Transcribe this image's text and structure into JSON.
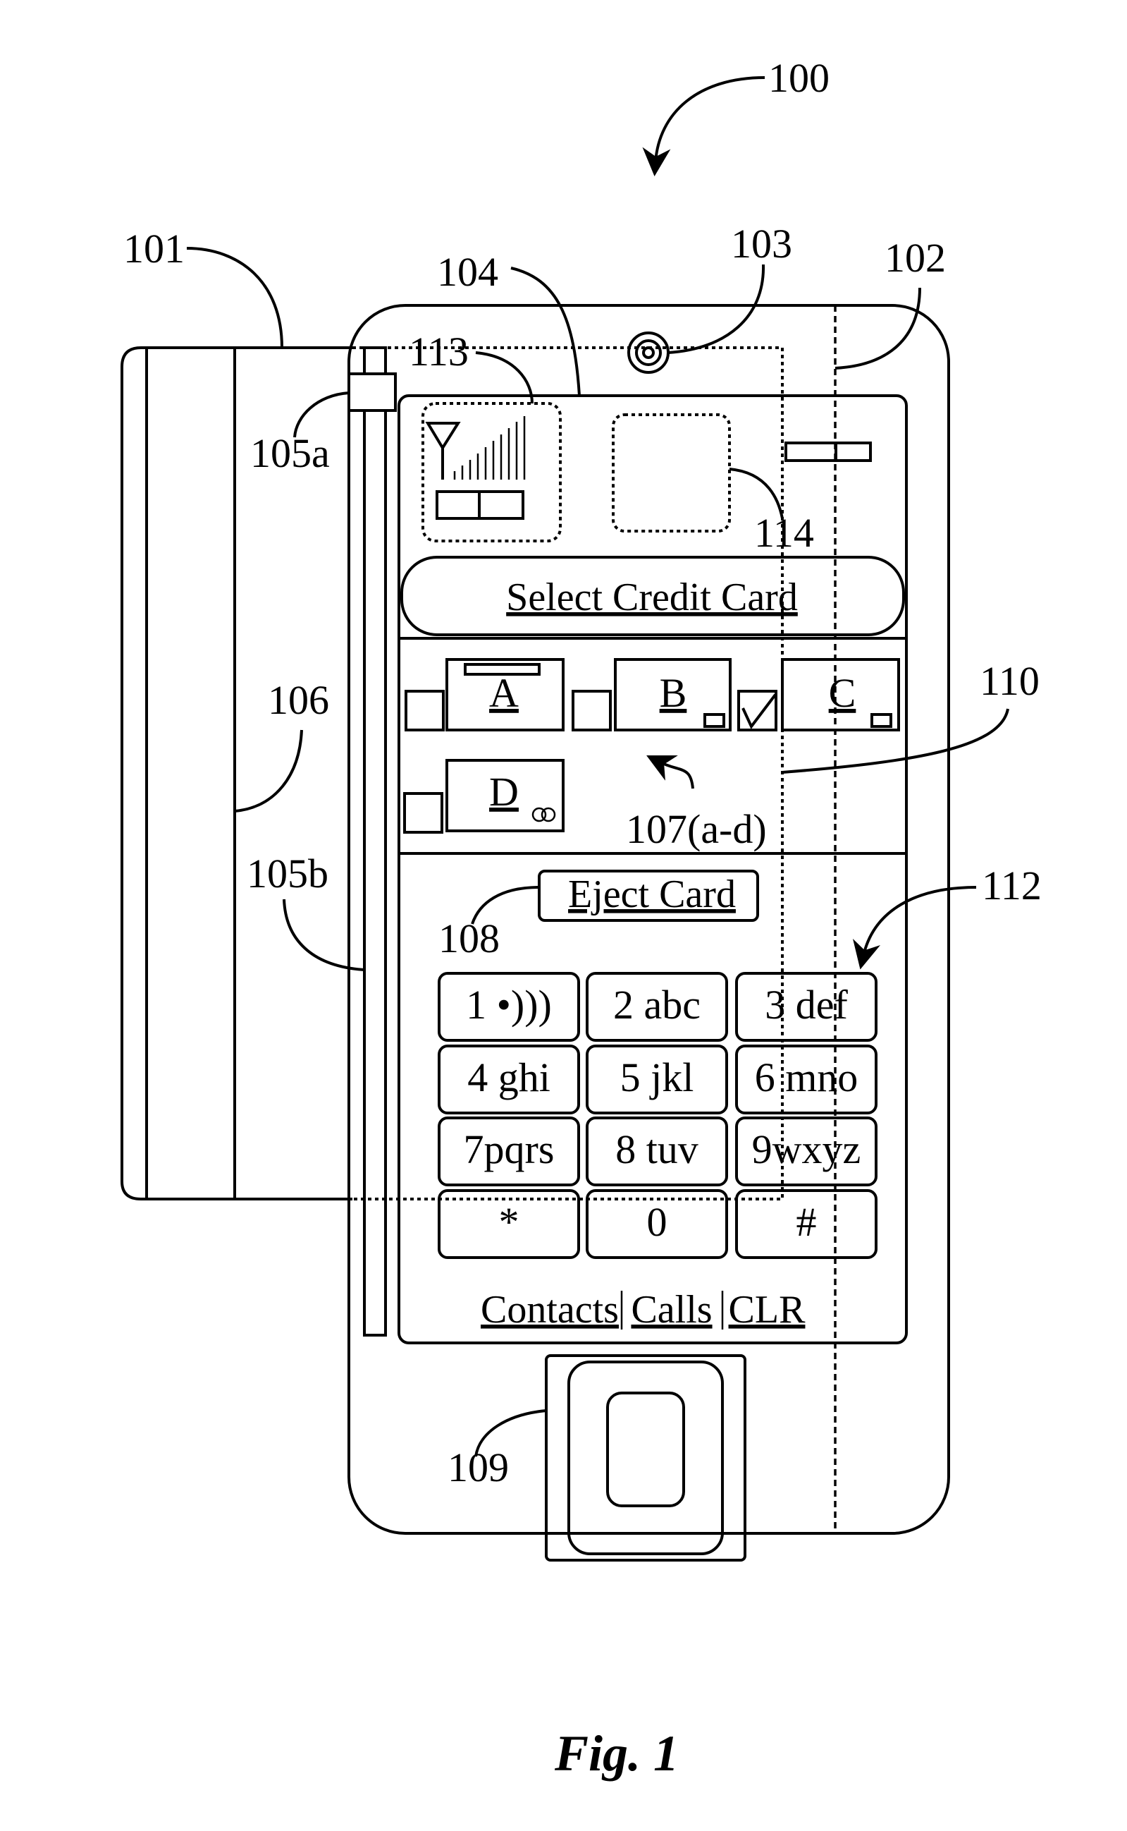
{
  "figure": {
    "caption": "Fig. 1",
    "reference_numerals": {
      "device": "100",
      "card": "101",
      "line_102": "102",
      "camera": "103",
      "screen": "104",
      "slot_top": "105a",
      "slot_bottom": "105b",
      "card_edge": "106",
      "card_icons": "107(a-d)",
      "eject_button": "108",
      "home_button": "109",
      "card_area": "110",
      "keypad": "112",
      "status_area": "113",
      "image_area": "114"
    }
  },
  "screen": {
    "title_button": "Select Credit Card",
    "cards": [
      {
        "label": "A",
        "checked": false
      },
      {
        "label": "B",
        "checked": false
      },
      {
        "label": "C",
        "checked": true
      },
      {
        "label": "D",
        "checked": false
      }
    ],
    "eject_button": "Eject Card",
    "keypad": [
      [
        "1 •)))",
        "2 abc",
        "3 def"
      ],
      [
        "4 ghi",
        "5 jkl",
        "6 mno"
      ],
      [
        "7pqrs",
        "8 tuv",
        "9wxyz"
      ],
      [
        "*",
        "0",
        "#"
      ]
    ],
    "bottom_links": [
      "Contacts",
      "Calls",
      "CLR"
    ]
  }
}
